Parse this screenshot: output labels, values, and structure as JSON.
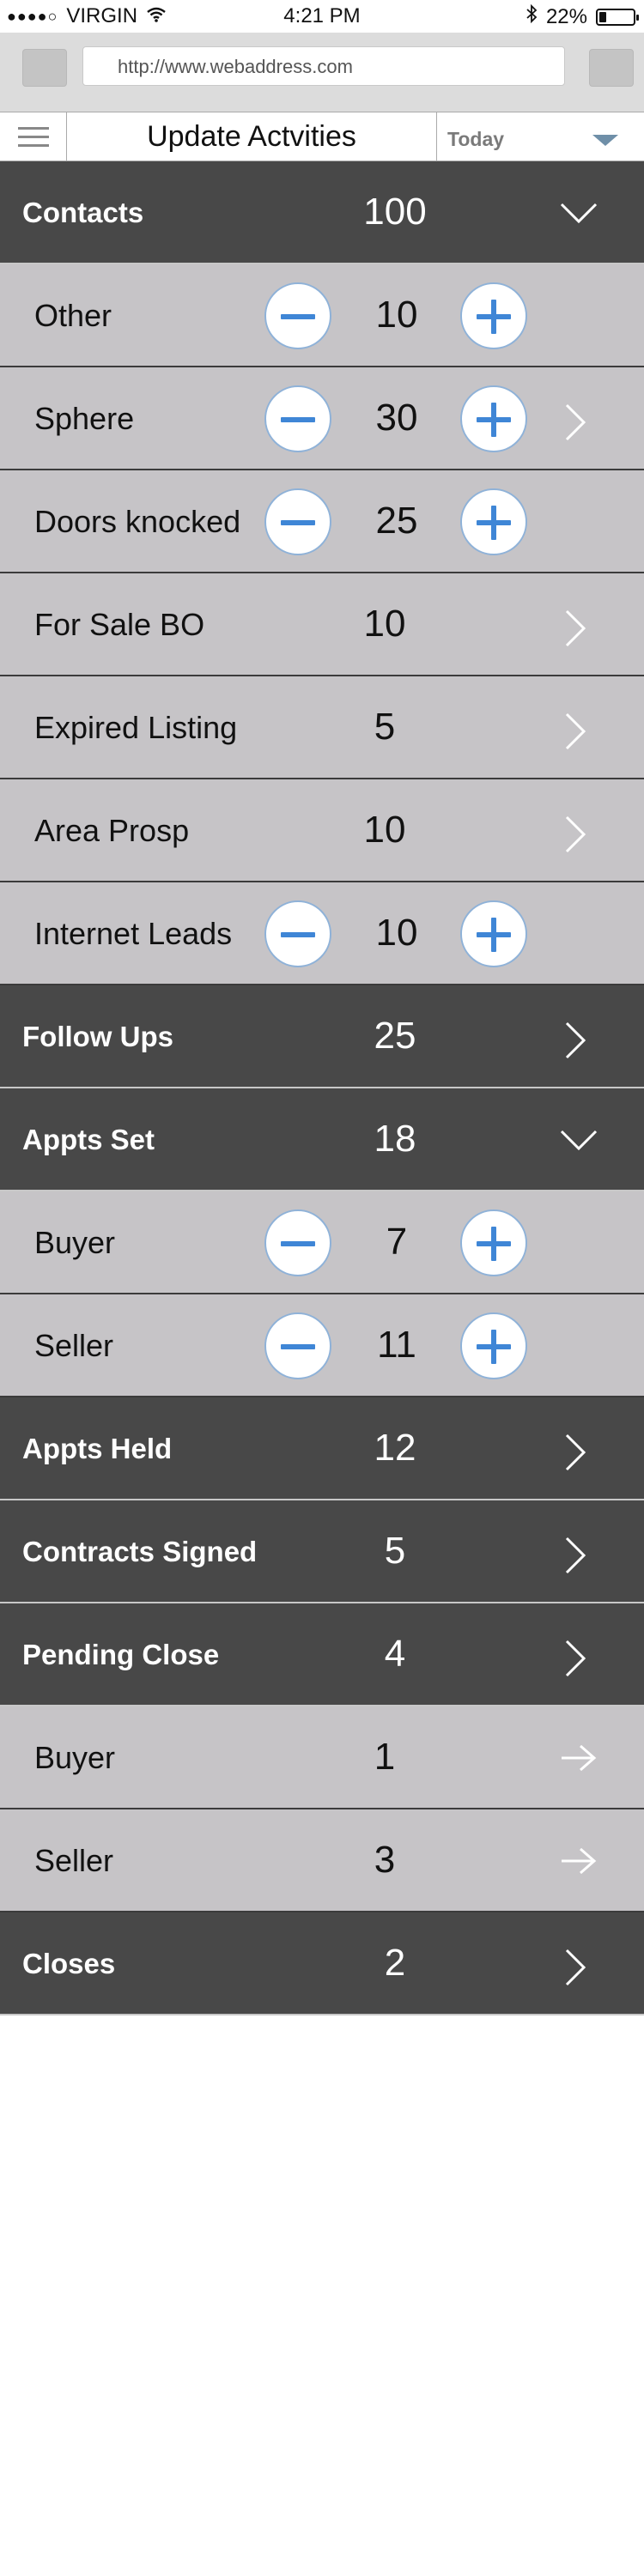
{
  "status_bar": {
    "signal": "●●●●○",
    "carrier": "VIRGIN",
    "time": "4:21 PM",
    "battery_text": "22%",
    "battery_level": 0.22
  },
  "browser": {
    "url": "http://www.webaddress.com"
  },
  "app_header": {
    "title": "Update Actvities",
    "period_selected": "Today"
  },
  "rows": [
    {
      "id": "contacts",
      "kind": "header",
      "label": "Contacts",
      "value": "100",
      "trailing": "chevron-down"
    },
    {
      "id": "other",
      "kind": "sub",
      "label": "Other",
      "value": "10",
      "stepper": true,
      "trailing": ""
    },
    {
      "id": "sphere",
      "kind": "sub",
      "label": "Sphere",
      "value": "30",
      "stepper": true,
      "trailing": "chevron-right"
    },
    {
      "id": "doors-knocked",
      "kind": "sub",
      "label": "Doors knocked",
      "value": "25",
      "stepper": true,
      "trailing": ""
    },
    {
      "id": "for-sale-bo",
      "kind": "sub",
      "label": "For Sale BO",
      "value": "10",
      "stepper": false,
      "trailing": "chevron-right"
    },
    {
      "id": "expired-listing",
      "kind": "sub",
      "label": "Expired Listing",
      "value": "5",
      "stepper": false,
      "trailing": "chevron-right"
    },
    {
      "id": "area-prosp",
      "kind": "sub",
      "label": "Area Prosp",
      "value": "10",
      "stepper": false,
      "trailing": "chevron-right"
    },
    {
      "id": "internet-leads",
      "kind": "sub",
      "label": "Internet Leads",
      "value": "10",
      "stepper": true,
      "trailing": ""
    },
    {
      "id": "follow-ups",
      "kind": "header",
      "label": "Follow Ups",
      "value": "25",
      "trailing": "chevron-right"
    },
    {
      "id": "appts-set",
      "kind": "header",
      "label": "Appts Set",
      "value": "18",
      "trailing": "chevron-down"
    },
    {
      "id": "appts-set-buyer",
      "kind": "sub",
      "label": "Buyer",
      "value": "7",
      "stepper": true,
      "trailing": ""
    },
    {
      "id": "appts-set-seller",
      "kind": "sub",
      "label": "Seller",
      "value": "11",
      "stepper": true,
      "trailing": ""
    },
    {
      "id": "appts-held",
      "kind": "header",
      "label": "Appts Held",
      "value": "12",
      "trailing": "chevron-right"
    },
    {
      "id": "contracts-signed",
      "kind": "header",
      "label": "Contracts Signed",
      "value": "5",
      "trailing": "chevron-right"
    },
    {
      "id": "pending-close",
      "kind": "header",
      "label": "Pending Close",
      "value": "4",
      "trailing": "chevron-right"
    },
    {
      "id": "pending-buyer",
      "kind": "sub",
      "label": "Buyer",
      "value": "1",
      "stepper": false,
      "trailing": "arrow-right"
    },
    {
      "id": "pending-seller",
      "kind": "sub",
      "label": "Seller",
      "value": "3",
      "stepper": false,
      "trailing": "arrow-right"
    },
    {
      "id": "closes",
      "kind": "header",
      "label": "Closes",
      "value": "2",
      "trailing": "chevron-right"
    }
  ]
}
